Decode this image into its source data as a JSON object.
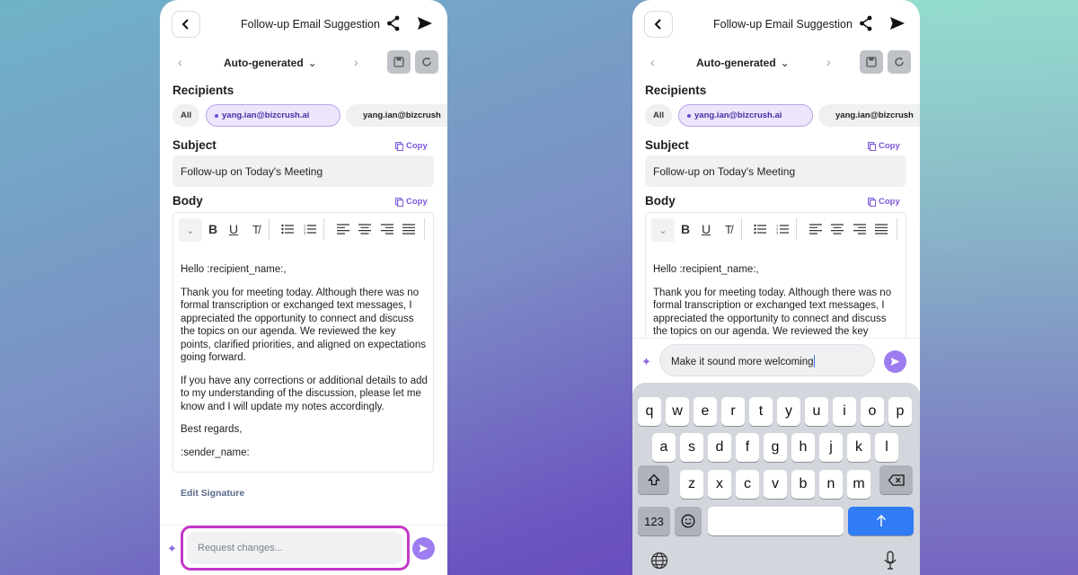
{
  "header": {
    "title": "Follow-up Email Suggestion"
  },
  "nav": {
    "version_label": "Auto-generated"
  },
  "recipients": {
    "label": "Recipients",
    "chips": [
      "All",
      "yang.ian@bizcrush.ai",
      "yang.ian@bizcrush"
    ]
  },
  "subject": {
    "label": "Subject",
    "copy_label": "Copy",
    "value": "Follow-up on Today's Meeting"
  },
  "body": {
    "label": "Body",
    "copy_label": "Copy",
    "greeting": "Hello :recipient_name:,",
    "para1": "Thank you for meeting today. Although there was no formal transcription or exchanged text messages, I appreciated the opportunity to connect and discuss the topics on our agenda. We reviewed the key points, clarified priorities, and aligned on expectations going forward.",
    "para1_partial": "Thank you for meeting today. Although there was no formal transcription or exchanged text messages, I appreciated the opportunity to connect and discuss the topics on our agenda. We reviewed the key",
    "para2": "If you have any corrections or additional details to add to my understanding of the discussion, please let me know and I will update my notes accordingly.",
    "closing": "Best regards,",
    "signature": ":sender_name:"
  },
  "edit_signature_label": "Edit Signature",
  "request": {
    "placeholder": "Request changes...",
    "typed_value": "Make it sound more welcoming"
  },
  "keyboard": {
    "row1": [
      "q",
      "w",
      "e",
      "r",
      "t",
      "y",
      "u",
      "i",
      "o",
      "p"
    ],
    "row2": [
      "a",
      "s",
      "d",
      "f",
      "g",
      "h",
      "j",
      "k",
      "l"
    ],
    "row3": [
      "z",
      "x",
      "c",
      "v",
      "b",
      "n",
      "m"
    ],
    "numbers_key": "123"
  },
  "colors": {
    "accent": "#9d7cf0",
    "highlight_outline": "#c338c8",
    "selected_chip_bg": "#ede5fb",
    "keyboard_return": "#2f7cf6"
  }
}
